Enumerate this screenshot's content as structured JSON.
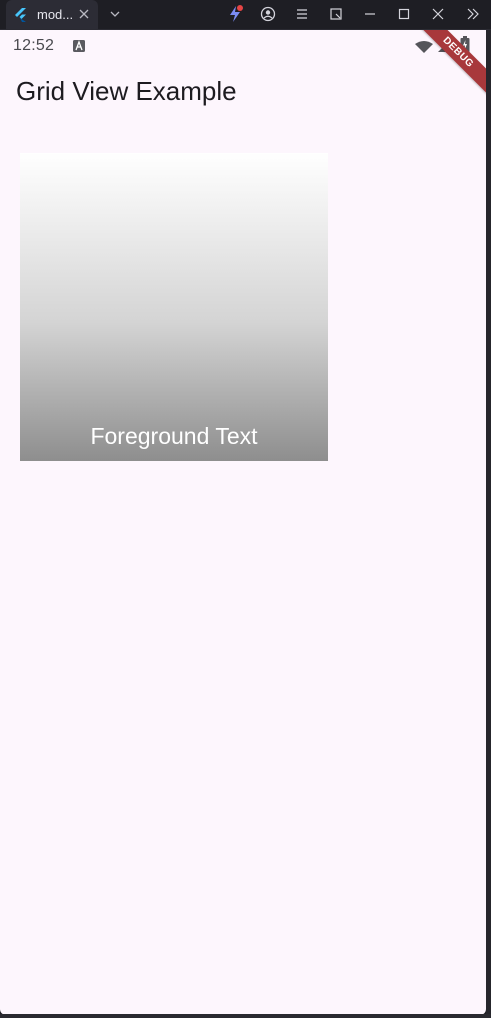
{
  "window": {
    "tab_title": "mod...",
    "icons": {
      "app": "flutter-logo-icon",
      "close": "close-icon",
      "dropdown": "chevron-down-icon",
      "dev_tools": "lightning-icon",
      "profile": "profile-icon",
      "menu": "menu-icon",
      "screenshot": "screenshot-icon",
      "minimize": "minimize-icon",
      "maximize": "maximize-icon",
      "window_close": "close-icon",
      "more": "double-chevron-right-icon"
    }
  },
  "status_bar": {
    "time": "12:52",
    "icons": [
      "notification-a-icon",
      "wifi-icon",
      "signal-icon",
      "battery-icon"
    ]
  },
  "debug_banner": "DEBUG",
  "app_bar": {
    "title": "Grid View Example"
  },
  "grid": {
    "items": [
      {
        "foreground_text": "Foreground Text",
        "gradient": [
          "#ffffff",
          "#8e8e8e"
        ]
      }
    ]
  },
  "colors": {
    "background": "#fdf6fd",
    "title_text": "#1d1b20",
    "debug_banner": "#a8383b"
  }
}
